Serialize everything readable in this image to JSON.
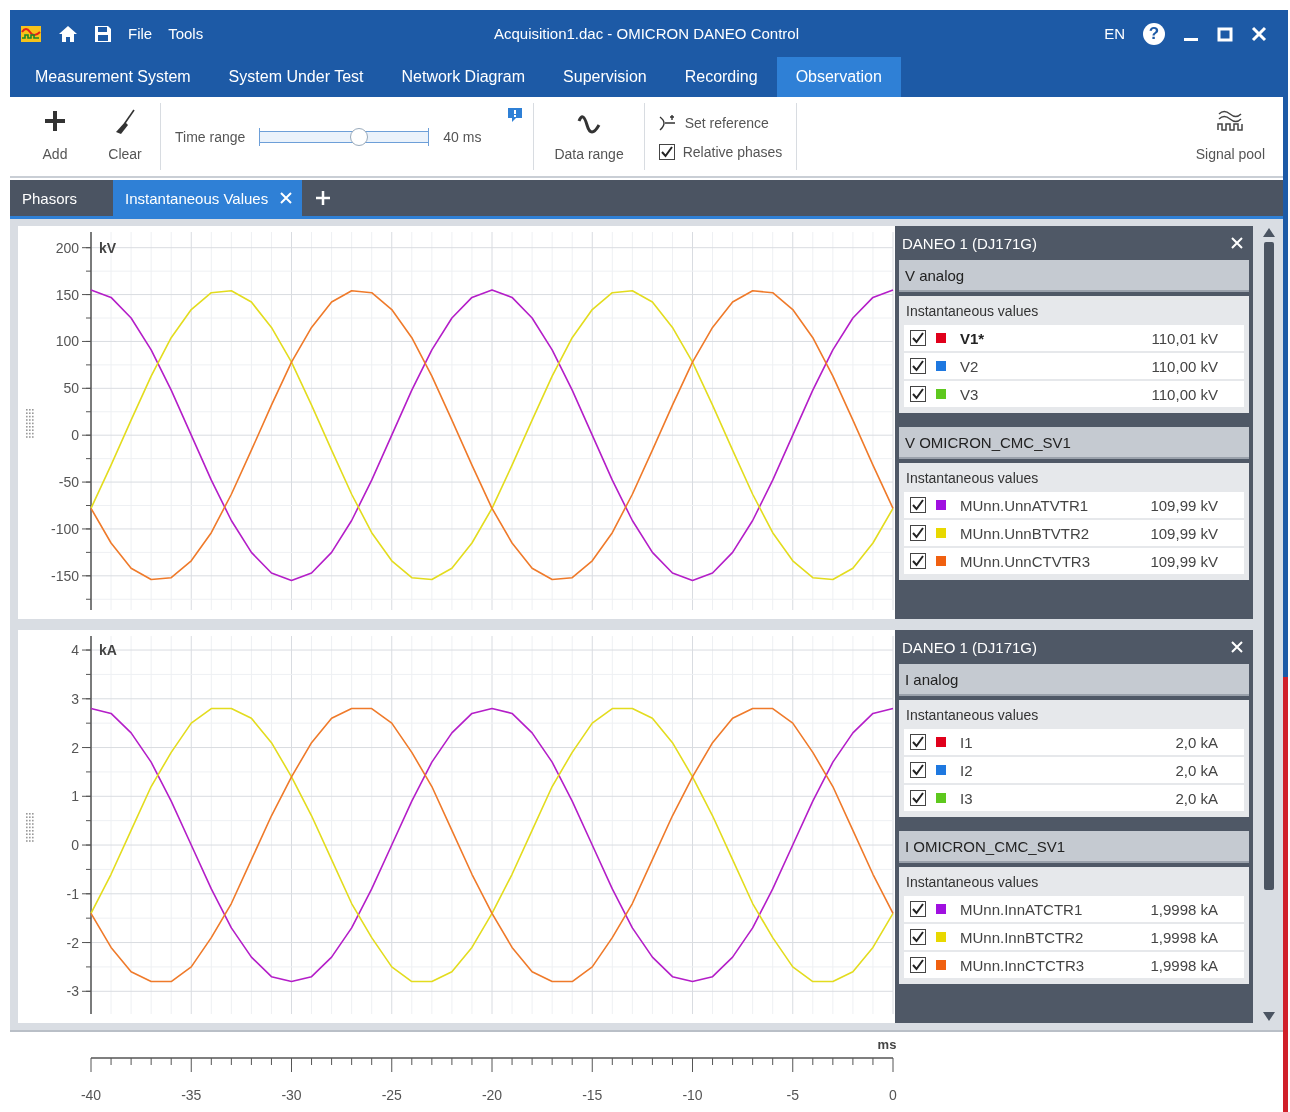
{
  "window": {
    "title": "Acquisition1.dac - OMICRON DANEO Control",
    "menu": [
      "File",
      "Tools"
    ],
    "language": "EN",
    "help": "?"
  },
  "ribbon_tabs": [
    {
      "label": "Measurement System",
      "selected": false
    },
    {
      "label": "System Under Test",
      "selected": false
    },
    {
      "label": "Network Diagram",
      "selected": false
    },
    {
      "label": "Supervision",
      "selected": false
    },
    {
      "label": "Recording",
      "selected": false
    },
    {
      "label": "Observation",
      "selected": true
    }
  ],
  "toolbar": {
    "add": "Add",
    "clear": "Clear",
    "time_range": {
      "label": "Time range",
      "level": 0.59,
      "reading": "40 ms"
    },
    "data_range": "Data range",
    "set_reference": "Set reference",
    "relative_phases": {
      "label": "Relative phases",
      "checked": true
    },
    "signal_pool": "Signal pool"
  },
  "doc_tabs": [
    {
      "label": "Phasors",
      "selected": false,
      "closable": false
    },
    {
      "label": "Instantaneous Values",
      "selected": true,
      "closable": true
    }
  ],
  "panels": [
    {
      "chart_data": {
        "type": "line",
        "ylabel": "kV",
        "grid": true,
        "ylim": [
          -195,
          221
        ],
        "yticks": [
          -150,
          -100,
          -50,
          0,
          50,
          100,
          150,
          200
        ],
        "categories": [
          null,
          null,
          null,
          null,
          null,
          null,
          null,
          null,
          null,
          null,
          null,
          null,
          null,
          null,
          null,
          null,
          null,
          null,
          null,
          null,
          null,
          null,
          null,
          null,
          null,
          null,
          null,
          null,
          null,
          null,
          null,
          null,
          null,
          null,
          null,
          null,
          null,
          null,
          null,
          null,
          null
        ],
        "series": [
          {
            "color": "#b41ec8",
            "values": [
              155,
              147,
              125,
              91,
              48,
              0,
              -48,
              -91,
              -125,
              -147,
              -155,
              -147,
              -125,
              -91,
              -48,
              0,
              48,
              91,
              125,
              147,
              155,
              147,
              125,
              91,
              48,
              0,
              -48,
              -91,
              -125,
              -147,
              -155,
              -147,
              -125,
              -91,
              -48,
              0,
              48,
              91,
              125,
              147,
              155
            ]
          },
          {
            "color": "#e3dc1e",
            "values": [
              -78,
              -32,
              16,
              63,
              104,
              134,
              152,
              154,
              142,
              115,
              78,
              32,
              -16,
              -63,
              -104,
              -134,
              -152,
              -154,
              -142,
              -115,
              -78,
              -32,
              16,
              63,
              104,
              134,
              152,
              154,
              142,
              115,
              78,
              32,
              -16,
              -63,
              -104,
              -134,
              -152,
              -154,
              -142,
              -115,
              -78
            ]
          },
          {
            "color": "#ef7a2a",
            "values": [
              -78,
              -115,
              -142,
              -154,
              -152,
              -134,
              -104,
              -63,
              -16,
              32,
              78,
              115,
              142,
              154,
              152,
              134,
              104,
              63,
              16,
              -32,
              -78,
              -115,
              -142,
              -154,
              -152,
              -134,
              -104,
              -63,
              -16,
              32,
              78,
              115,
              142,
              154,
              152,
              134,
              104,
              63,
              16,
              -32,
              -78
            ]
          }
        ]
      },
      "legend": {
        "title": "DANEO 1 (DJ171G)",
        "groups": [
          {
            "title": "V analog",
            "subtitle": "Instantaneous values",
            "channels": [
              {
                "name": "V1*",
                "value": "110,01 kV",
                "checked": true,
                "bold": true,
                "color": "#e0001b"
              },
              {
                "name": "V2",
                "value": "110,00 kV",
                "checked": true,
                "bold": false,
                "color": "#1e78e0"
              },
              {
                "name": "V3",
                "value": "110,00 kV",
                "checked": true,
                "bold": false,
                "color": "#5ec81e"
              }
            ]
          },
          {
            "title": "V OMICRON_CMC_SV1",
            "subtitle": "Instantaneous values",
            "channels": [
              {
                "name": "MUnn.UnnATVTR1",
                "value": "109,99 kV",
                "checked": true,
                "bold": false,
                "color": "#a010e0"
              },
              {
                "name": "MUnn.UnnBTVTR2",
                "value": "109,99 kV",
                "checked": true,
                "bold": false,
                "color": "#e8d800"
              },
              {
                "name": "MUnn.UnnCTVTR3",
                "value": "109,99 kV",
                "checked": true,
                "bold": false,
                "color": "#f06010"
              }
            ]
          }
        ]
      }
    },
    {
      "chart_data": {
        "type": "line",
        "ylabel": "kA",
        "grid": true,
        "ylim": [
          -3.63,
          4.37
        ],
        "yticks": [
          -3,
          -2,
          -1,
          0,
          1,
          2,
          3,
          4
        ],
        "categories": [
          null,
          null,
          null,
          null,
          null,
          null,
          null,
          null,
          null,
          null,
          null,
          null,
          null,
          null,
          null,
          null,
          null,
          null,
          null,
          null,
          null,
          null,
          null,
          null,
          null,
          null,
          null,
          null,
          null,
          null,
          null,
          null,
          null,
          null,
          null,
          null,
          null,
          null,
          null,
          null,
          null
        ],
        "series": [
          {
            "color": "#b41ec8",
            "values": [
              2.8,
              2.7,
              2.3,
              1.7,
              0.9,
              0,
              -0.9,
              -1.7,
              -2.3,
              -2.7,
              -2.8,
              -2.7,
              -2.3,
              -1.7,
              -0.9,
              0,
              0.9,
              1.7,
              2.3,
              2.7,
              2.8,
              2.7,
              2.3,
              1.7,
              0.9,
              0,
              -0.9,
              -1.7,
              -2.3,
              -2.7,
              -2.8,
              -2.7,
              -2.3,
              -1.7,
              -0.9,
              0,
              0.9,
              1.7,
              2.3,
              2.7,
              2.8
            ]
          },
          {
            "color": "#e3dc1e",
            "values": [
              -1.4,
              -0.6,
              0.3,
              1.2,
              1.9,
              2.5,
              2.8,
              2.8,
              2.6,
              2.1,
              1.4,
              0.6,
              -0.3,
              -1.2,
              -1.9,
              -2.5,
              -2.8,
              -2.8,
              -2.6,
              -2.1,
              -1.4,
              -0.6,
              0.3,
              1.2,
              1.9,
              2.5,
              2.8,
              2.8,
              2.6,
              2.1,
              1.4,
              0.6,
              -0.3,
              -1.2,
              -1.9,
              -2.5,
              -2.8,
              -2.8,
              -2.6,
              -2.1,
              -1.4
            ]
          },
          {
            "color": "#ef7a2a",
            "values": [
              -1.4,
              -2.1,
              -2.6,
              -2.8,
              -2.8,
              -2.5,
              -1.9,
              -1.2,
              -0.3,
              0.6,
              1.4,
              2.1,
              2.6,
              2.8,
              2.8,
              2.5,
              1.9,
              1.2,
              0.3,
              -0.6,
              -1.4,
              -2.1,
              -2.6,
              -2.8,
              -2.8,
              -2.5,
              -1.9,
              -1.2,
              -0.3,
              0.6,
              1.4,
              2.1,
              2.6,
              2.8,
              2.8,
              2.5,
              1.9,
              1.2,
              0.3,
              -0.6,
              -1.4
            ]
          }
        ]
      },
      "legend": {
        "title": "DANEO 1 (DJ171G)",
        "groups": [
          {
            "title": "I analog",
            "subtitle": "Instantaneous values",
            "channels": [
              {
                "name": "I1",
                "value": "2,0 kA",
                "checked": true,
                "bold": false,
                "color": "#e0001b"
              },
              {
                "name": "I2",
                "value": "2,0 kA",
                "checked": true,
                "bold": false,
                "color": "#1e78e0"
              },
              {
                "name": "I3",
                "value": "2,0 kA",
                "checked": true,
                "bold": false,
                "color": "#5ec81e"
              }
            ]
          },
          {
            "title": "I OMICRON_CMC_SV1",
            "subtitle": "Instantaneous values",
            "channels": [
              {
                "name": "MUnn.InnATCTR1",
                "value": "1,9998 kA",
                "checked": true,
                "bold": false,
                "color": "#a010e0"
              },
              {
                "name": "MUnn.InnBTCTR2",
                "value": "1,9998 kA",
                "checked": true,
                "bold": false,
                "color": "#e8d800"
              },
              {
                "name": "MUnn.InnCTCTR3",
                "value": "1,9998 kA",
                "checked": true,
                "bold": false,
                "color": "#f06010"
              }
            ]
          }
        ]
      }
    }
  ],
  "time_axis": {
    "unit": "ms",
    "labels": [
      "-40",
      "-35",
      "-30",
      "-25",
      "-20",
      "-15",
      "-10",
      "-5",
      "0"
    ]
  }
}
